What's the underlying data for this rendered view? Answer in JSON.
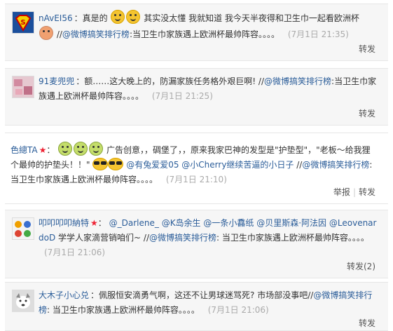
{
  "comments": [
    {
      "username": "nAvEI56",
      "sep": "：",
      "text1": "真是的",
      "text2": "其实没太懂 我就知道 我今天半夜得和卫生巾一起看欧洲杯",
      "text3": "//",
      "mention": "@微博搞笑排行榜",
      "text4": ":当卫生巾家族遇上欧洲杯最帅阵容。。。。",
      "time": "(7月1日 21:35)",
      "action_repost": "转发"
    },
    {
      "username": "91麦兜兜",
      "sep": "：",
      "text1": "额……这大晚上的，防漏家族任务格外艰巨啊! //",
      "mention": "@微博搞笑排行榜",
      "text2": ":当卫生巾家族遇上欧洲杯最帅阵容。。。。",
      "time": "(7月1日 21:25)",
      "action_repost": "转发"
    },
    {
      "username": "色總TA",
      "sep": "：",
      "text1": "广告创意，，碉堡了，，原来我家巴神的发型是\"护垫型\"，\"老板～给我狸个最帅的护垫头！！\"",
      "mention1": "@有兔爱爱05",
      "mention2": "@小Cherry继续苦逼的小日子",
      "text2": "//",
      "mention3": "@微博搞笑排行榜",
      "text3": ":当卫生巾家族遇上欧洲杯最帅阵容。。。。",
      "time": "(7月1日 21:10)",
      "action_report": "举报",
      "action_sep": "|",
      "action_repost": "转发"
    },
    {
      "username": "叩叩叩叩納特",
      "sep": "：",
      "mention1": "@_Darlene_",
      "mention2": "@K岛余生",
      "mention3": "@一条小馫纸",
      "mention4": "@贝里斯森·阿法因",
      "mention5": "@LeovenardoD",
      "text1": "学学人家滴营销咱们~ //",
      "mention6": "@微博搞笑排行榜",
      "text2": ": 当卫生巾家族遇上欧洲杯最帅阵容。。。。",
      "time": "(7月1日 21:06)",
      "action_repost": "转发(2)"
    },
    {
      "username": "大木子小心兑",
      "sep": "：",
      "text1": "佩服恒安滴勇气啊，这还不让男球迷骂死? 市场部没事吧//",
      "mention": "@微博搞笑排行榜",
      "text2": ": 当卫生巾家族遇上欧洲杯最帅阵容。。。。",
      "time": "(7月1日 21:06)",
      "action_repost": "转发"
    }
  ],
  "colors": {
    "link": "#2b5d99",
    "bg": "#f6f6f6",
    "star": "#e23"
  },
  "icons": [
    "superman-avatar",
    "blurred-avatar",
    "star-badge-icon",
    "emoticon-face-icon",
    "sunglasses-emoticon-icon",
    "cartoon-avatar",
    "dog-avatar"
  ]
}
